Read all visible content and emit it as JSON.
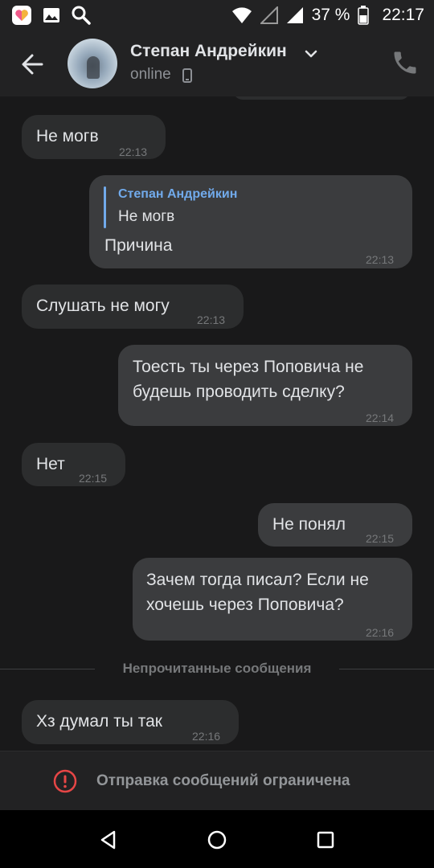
{
  "status_bar": {
    "battery_percent": "37 %",
    "time": "22:17",
    "icons": [
      "photo-app-icon",
      "gallery-icon",
      "search-icon",
      "wifi-icon",
      "signal-empty-icon",
      "signal-icon",
      "battery-icon"
    ]
  },
  "header": {
    "contact_name": "Степан Андрейкин",
    "status": "online",
    "icons": [
      "back-arrow-icon",
      "chevron-down-icon",
      "mobile-icon",
      "phone-icon"
    ]
  },
  "messages": [
    {
      "direction": "in",
      "text": "Не могв",
      "time": "22:13"
    },
    {
      "direction": "out",
      "reply_author": "Степан Андрейкин",
      "reply_text": "Не могв",
      "text": "Причина",
      "time": "22:13"
    },
    {
      "direction": "in",
      "text": "Слушать не могу",
      "time": "22:13"
    },
    {
      "direction": "out",
      "lines": [
        "Тоесть ты через Поповича не",
        "будешь проводить сделку?"
      ],
      "time": "22:14"
    },
    {
      "direction": "in",
      "text": "Нет",
      "time": "22:15"
    },
    {
      "direction": "out",
      "text": "Не понял",
      "time": "22:15"
    },
    {
      "direction": "out",
      "lines": [
        "Зачем тогда писал? Если не",
        "хочешь через Поповича?"
      ],
      "time": "22:16"
    },
    {
      "direction": "in",
      "text": "Хз думал ты так",
      "time": "22:16"
    }
  ],
  "unread_divider": "Непрочитанные сообщения",
  "restriction_notice": "Отправка сообщений ограничена",
  "colors": {
    "background": "#19191a",
    "header": "#222223",
    "incoming_bubble": "#2c2d2e",
    "outgoing_bubble": "#3b3c3e",
    "accent": "#71aaeb",
    "warning": "#e64646"
  },
  "nav_bar": {
    "icons": [
      "back-triangle-icon",
      "home-circle-icon",
      "recents-square-icon"
    ]
  }
}
